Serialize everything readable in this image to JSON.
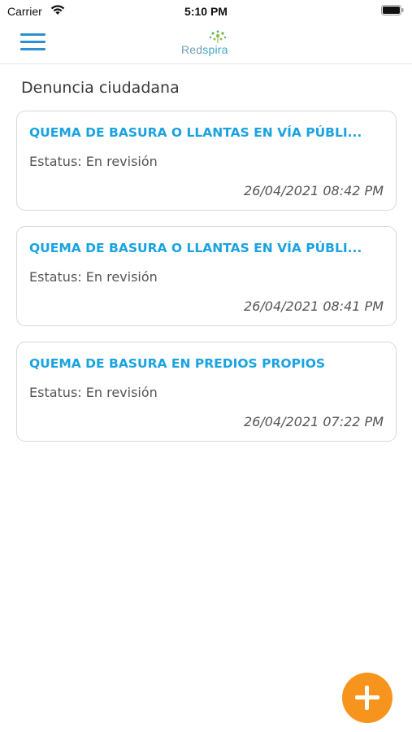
{
  "status_bar": {
    "carrier": "Carrier",
    "time": "5:10 PM"
  },
  "nav": {
    "logo_part1": "Red",
    "logo_part2": "spira",
    "menu_icon": "hamburger-menu-icon"
  },
  "page": {
    "title": "Denuncia ciudadana"
  },
  "reports": [
    {
      "title": "QUEMA DE BASURA O LLANTAS EN VÍA PÚBLI...",
      "status": "Estatus: En revisión",
      "date": "26/04/2021 08:42 PM"
    },
    {
      "title": "QUEMA DE BASURA O LLANTAS EN VÍA PÚBLI...",
      "status": "Estatus: En revisión",
      "date": "26/04/2021 08:41 PM"
    },
    {
      "title": "QUEMA DE BASURA EN PREDIOS PROPIOS",
      "status": "Estatus: En revisión",
      "date": "26/04/2021 07:22 PM"
    }
  ],
  "fab": {
    "icon": "plus-icon"
  },
  "colors": {
    "accent_blue": "#1aa3e0",
    "menu_blue": "#2e8fd2",
    "fab_orange": "#f7941d",
    "card_border": "#d9d9d9"
  }
}
